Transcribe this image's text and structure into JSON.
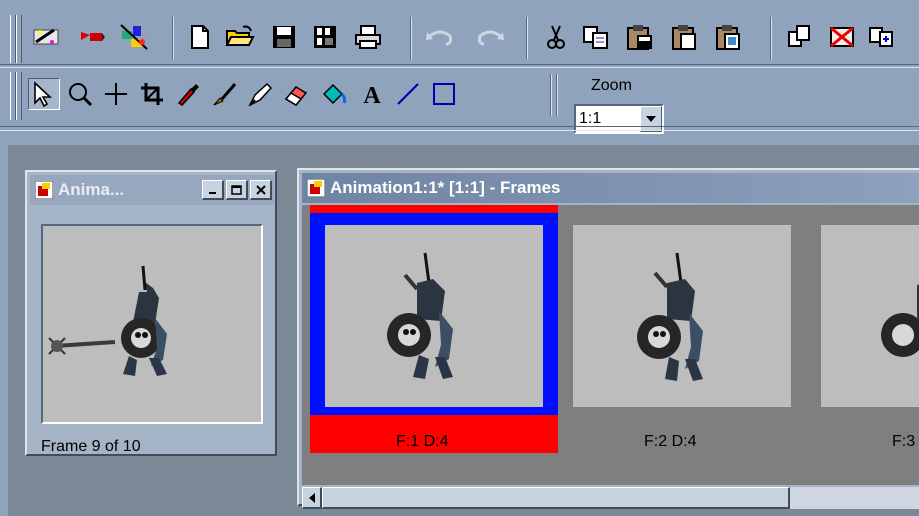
{
  "toolbar_top": {
    "icons": [
      "wizard-icon",
      "animation-icon",
      "effects-icon",
      "new-file-icon",
      "open-folder-icon",
      "save-icon",
      "save-all-icon",
      "print-icon",
      "undo-icon",
      "redo-icon",
      "cut-icon",
      "copy-icon",
      "paste-icon",
      "paste-new-icon",
      "paste-frame-icon",
      "duplicate-icon",
      "delete-frame-icon",
      "insert-frame-icon"
    ]
  },
  "toolbar_tools": {
    "icons": [
      "pointer-icon",
      "zoom-icon",
      "crosshair-icon",
      "crop-icon",
      "dropper-icon",
      "brush-icon",
      "pen-icon",
      "eraser-icon",
      "fill-icon",
      "text-icon",
      "line-icon",
      "rectangle-icon"
    ]
  },
  "zoom": {
    "label": "Zoom",
    "value": "1:1"
  },
  "preview_window": {
    "title": "Anima...",
    "status": "Frame 9 of 10"
  },
  "frames_window": {
    "title": "Animation1:1* [1:1] - Frames",
    "frames": [
      {
        "label": "F:1  D:4",
        "selected": true
      },
      {
        "label": "F:2  D:4",
        "selected": false
      },
      {
        "label": "F:3",
        "selected": false
      }
    ]
  },
  "colors": {
    "selection_outer": "#ff0000",
    "selection_inner": "#0010ff",
    "frame_bg": "#bdbdbd"
  }
}
